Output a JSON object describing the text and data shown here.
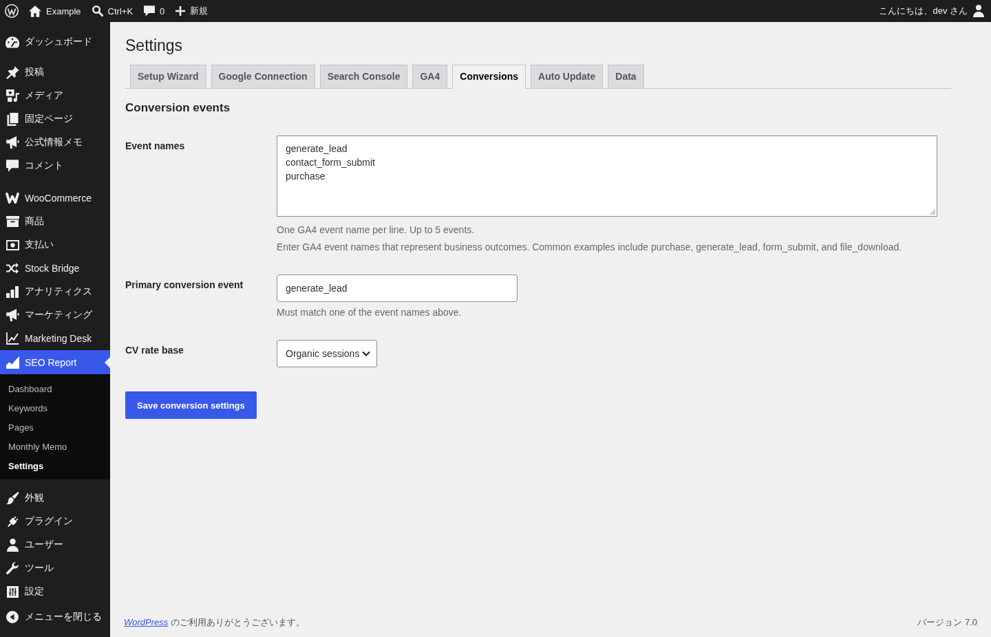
{
  "admin_bar": {
    "site_name": "Example",
    "search_shortcut": "Ctrl+K",
    "comment_count": "0",
    "new_label": "新規",
    "greeting": "こんにちは、dev さん"
  },
  "sidebar": {
    "groups": [
      {
        "items": [
          {
            "label": "ダッシュボード",
            "selected": false
          }
        ]
      },
      {
        "items": [
          {
            "label": "投稿",
            "selected": false
          },
          {
            "label": "メディア",
            "selected": false
          },
          {
            "label": "固定ページ",
            "selected": false
          },
          {
            "label": "公式情報メモ",
            "selected": false
          },
          {
            "label": "コメント",
            "selected": false
          }
        ]
      },
      {
        "items": [
          {
            "label": "WooCommerce",
            "selected": false
          },
          {
            "label": "商品",
            "selected": false
          },
          {
            "label": "支払い",
            "selected": false
          },
          {
            "label": "Stock Bridge",
            "selected": false
          },
          {
            "label": "アナリティクス",
            "selected": false
          },
          {
            "label": "マーケティング",
            "selected": false
          },
          {
            "label": "Marketing Desk",
            "selected": false
          },
          {
            "label": "SEO Report",
            "selected": true,
            "children": [
              {
                "label": "Dashboard",
                "selected": false
              },
              {
                "label": "Keywords",
                "selected": false
              },
              {
                "label": "Pages",
                "selected": false
              },
              {
                "label": "Monthly Memo",
                "selected": false
              },
              {
                "label": "Settings",
                "selected": true
              }
            ]
          }
        ]
      },
      {
        "items": [
          {
            "label": "外観",
            "selected": false
          },
          {
            "label": "プラグイン",
            "selected": false
          },
          {
            "label": "ユーザー",
            "selected": false
          },
          {
            "label": "ツール",
            "selected": false
          },
          {
            "label": "設定",
            "selected": false
          }
        ]
      }
    ],
    "collapse_label": "メニューを閉じる"
  },
  "page": {
    "title": "Settings",
    "tabs": [
      {
        "label": "Setup Wizard",
        "selected": false
      },
      {
        "label": "Google Connection",
        "selected": false
      },
      {
        "label": "Search Console",
        "selected": false
      },
      {
        "label": "GA4",
        "selected": false
      },
      {
        "label": "Conversions",
        "selected": true
      },
      {
        "label": "Auto Update",
        "selected": false
      },
      {
        "label": "Data",
        "selected": false
      }
    ],
    "section_title": "Conversion events",
    "fields": [
      {
        "kind": "textarea",
        "label": "Event names",
        "value": "generate_lead\ncontact_form_submit\npurchase",
        "descriptions": [
          "One GA4 event name per line. Up to 5 events.",
          "Enter GA4 event names that represent business outcomes. Common examples include purchase, generate_lead, form_submit, and file_download."
        ]
      },
      {
        "kind": "text",
        "label": "Primary conversion event",
        "value": "generate_lead",
        "descriptions": [
          "Must match one of the event names above."
        ]
      },
      {
        "kind": "select",
        "label": "CV rate base",
        "value": "Organic sessions"
      }
    ],
    "save_button": "Save conversion settings"
  },
  "footer": {
    "thanks_link": "WordPress",
    "thanks_text": "のご利用ありがとうございます。",
    "version": "バージョン 7.0"
  }
}
